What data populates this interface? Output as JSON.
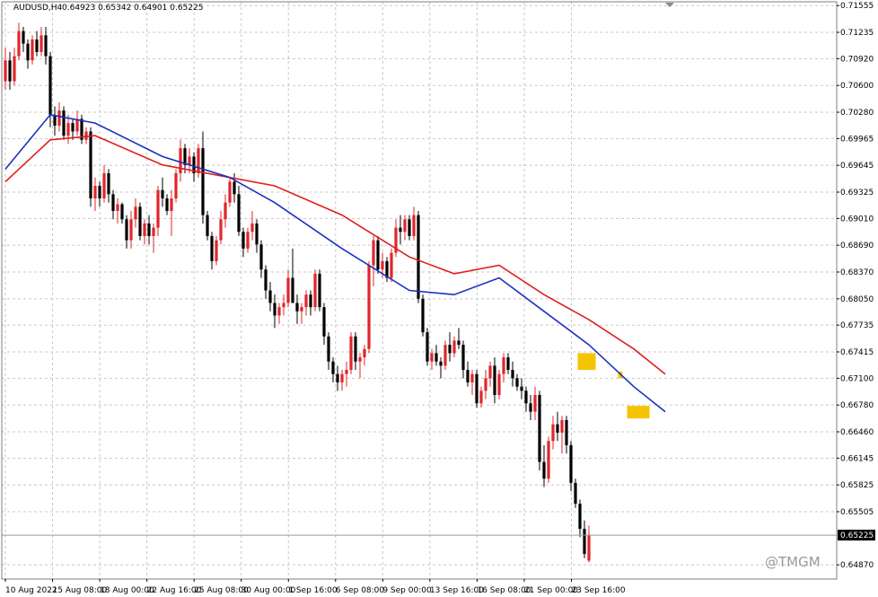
{
  "header": {
    "symbol": "AUDUSD,H4",
    "ohlc": "0.64923 0.65342 0.64901 0.65225"
  },
  "watermark": "@TMGM",
  "current_price_label": "0.65225",
  "colors": {
    "grid": "#c8c8c8",
    "bull": "#e0262b",
    "bear": "#000000",
    "ma_fast": "#1a2fc0",
    "ma_slow": "#e01e1e",
    "highlight": "#f5c400",
    "current_price_box": "#000000"
  },
  "chart_data": {
    "type": "candlestick",
    "title": "",
    "y_ticks": [
      "0.71555",
      "0.71235",
      "0.70920",
      "0.70600",
      "0.70280",
      "0.69965",
      "0.69645",
      "0.69325",
      "0.69010",
      "0.68690",
      "0.68370",
      "0.68050",
      "0.67735",
      "0.67415",
      "0.67100",
      "0.66780",
      "0.66460",
      "0.66145",
      "0.65825",
      "0.65505",
      "0.64870"
    ],
    "x_ticks": [
      "10 Aug 2022",
      "15 Aug 08:00",
      "18 Aug 00:00",
      "22 Aug 16:00",
      "25 Aug 08:00",
      "30 Aug 00:00",
      "1 Sep 16:00",
      "6 Sep 08:00",
      "9 Sep 00:00",
      "13 Sep 16:00",
      "16 Sep 08:00",
      "21 Sep 00:00",
      "23 Sep 16:00"
    ],
    "ylim": [
      0.647,
      0.716
    ],
    "candles": [
      [
        0.7065,
        0.7105,
        0.7055,
        0.709
      ],
      [
        0.709,
        0.71,
        0.7055,
        0.7065
      ],
      [
        0.7065,
        0.7105,
        0.706,
        0.7095
      ],
      [
        0.7095,
        0.7135,
        0.709,
        0.7125
      ],
      [
        0.7125,
        0.713,
        0.71,
        0.711
      ],
      [
        0.711,
        0.7115,
        0.708,
        0.709
      ],
      [
        0.709,
        0.712,
        0.7085,
        0.7115
      ],
      [
        0.7115,
        0.7125,
        0.7095,
        0.71
      ],
      [
        0.71,
        0.713,
        0.7095,
        0.712
      ],
      [
        0.712,
        0.713,
        0.7085,
        0.7095
      ],
      [
        0.7095,
        0.71,
        0.701,
        0.7025
      ],
      [
        0.7025,
        0.7035,
        0.7,
        0.7012
      ],
      [
        0.7012,
        0.704,
        0.7005,
        0.703
      ],
      [
        0.703,
        0.7035,
        0.6995,
        0.7
      ],
      [
        0.7,
        0.7025,
        0.699,
        0.7015
      ],
      [
        0.7015,
        0.702,
        0.6995,
        0.7005
      ],
      [
        0.7005,
        0.703,
        0.7,
        0.702
      ],
      [
        0.702,
        0.7025,
        0.699,
        0.6995
      ],
      [
        0.6995,
        0.701,
        0.699,
        0.7005
      ],
      [
        0.7005,
        0.701,
        0.6915,
        0.6925
      ],
      [
        0.6925,
        0.695,
        0.691,
        0.694
      ],
      [
        0.694,
        0.6945,
        0.6915,
        0.6925
      ],
      [
        0.6925,
        0.6965,
        0.692,
        0.6955
      ],
      [
        0.6955,
        0.696,
        0.692,
        0.693
      ],
      [
        0.693,
        0.6935,
        0.69,
        0.691
      ],
      [
        0.691,
        0.6925,
        0.6895,
        0.6918
      ],
      [
        0.6918,
        0.692,
        0.6895,
        0.69
      ],
      [
        0.69,
        0.6905,
        0.6865,
        0.6875
      ],
      [
        0.6875,
        0.691,
        0.6865,
        0.69
      ],
      [
        0.69,
        0.6925,
        0.689,
        0.6915
      ],
      [
        0.6915,
        0.692,
        0.6875,
        0.688
      ],
      [
        0.688,
        0.69,
        0.687,
        0.6895
      ],
      [
        0.6895,
        0.6905,
        0.687,
        0.688
      ],
      [
        0.688,
        0.6895,
        0.686,
        0.689
      ],
      [
        0.689,
        0.694,
        0.688,
        0.6935
      ],
      [
        0.6935,
        0.695,
        0.6915,
        0.6925
      ],
      [
        0.6925,
        0.693,
        0.6905,
        0.691
      ],
      [
        0.691,
        0.6935,
        0.688,
        0.6925
      ],
      [
        0.6925,
        0.696,
        0.692,
        0.6955
      ],
      [
        0.6955,
        0.6995,
        0.6945,
        0.6985
      ],
      [
        0.6985,
        0.699,
        0.6955,
        0.6965
      ],
      [
        0.6965,
        0.6985,
        0.6955,
        0.6975
      ],
      [
        0.6975,
        0.698,
        0.6945,
        0.6955
      ],
      [
        0.6955,
        0.699,
        0.695,
        0.6985
      ],
      [
        0.6985,
        0.7005,
        0.6895,
        0.6905
      ],
      [
        0.6905,
        0.691,
        0.6875,
        0.688
      ],
      [
        0.688,
        0.6885,
        0.684,
        0.685
      ],
      [
        0.685,
        0.688,
        0.6845,
        0.6875
      ],
      [
        0.6875,
        0.691,
        0.687,
        0.69
      ],
      [
        0.69,
        0.693,
        0.689,
        0.692
      ],
      [
        0.692,
        0.695,
        0.6915,
        0.6945
      ],
      [
        0.6945,
        0.6955,
        0.692,
        0.693
      ],
      [
        0.693,
        0.694,
        0.688,
        0.6885
      ],
      [
        0.6885,
        0.689,
        0.6855,
        0.6865
      ],
      [
        0.6865,
        0.689,
        0.686,
        0.6885
      ],
      [
        0.6885,
        0.691,
        0.6875,
        0.6895
      ],
      [
        0.6895,
        0.69,
        0.686,
        0.687
      ],
      [
        0.687,
        0.6875,
        0.683,
        0.684
      ],
      [
        0.684,
        0.6845,
        0.6805,
        0.6815
      ],
      [
        0.6815,
        0.6825,
        0.679,
        0.68
      ],
      [
        0.68,
        0.681,
        0.677,
        0.6785
      ],
      [
        0.6785,
        0.68,
        0.6775,
        0.6795
      ],
      [
        0.6795,
        0.681,
        0.6785,
        0.68
      ],
      [
        0.68,
        0.684,
        0.6795,
        0.683
      ],
      [
        0.683,
        0.6865,
        0.6825,
        0.68
      ],
      [
        0.68,
        0.681,
        0.6775,
        0.679
      ],
      [
        0.679,
        0.68,
        0.6775,
        0.6795
      ],
      [
        0.6795,
        0.6815,
        0.6785,
        0.681
      ],
      [
        0.681,
        0.6815,
        0.6785,
        0.6795
      ],
      [
        0.6795,
        0.684,
        0.679,
        0.6835
      ],
      [
        0.6835,
        0.684,
        0.679,
        0.6795
      ],
      [
        0.6795,
        0.68,
        0.675,
        0.676
      ],
      [
        0.676,
        0.6765,
        0.672,
        0.673
      ],
      [
        0.673,
        0.6735,
        0.6705,
        0.6715
      ],
      [
        0.6715,
        0.6725,
        0.6695,
        0.6705
      ],
      [
        0.6705,
        0.672,
        0.6695,
        0.6715
      ],
      [
        0.6715,
        0.673,
        0.67,
        0.672
      ],
      [
        0.672,
        0.6765,
        0.6715,
        0.676
      ],
      [
        0.676,
        0.6765,
        0.672,
        0.673
      ],
      [
        0.673,
        0.674,
        0.671,
        0.6735
      ],
      [
        0.6735,
        0.675,
        0.6725,
        0.6745
      ],
      [
        0.6745,
        0.685,
        0.674,
        0.6845
      ],
      [
        0.6845,
        0.688,
        0.682,
        0.6875
      ],
      [
        0.6875,
        0.688,
        0.6835,
        0.684
      ],
      [
        0.684,
        0.686,
        0.683,
        0.685
      ],
      [
        0.685,
        0.6855,
        0.6825,
        0.683
      ],
      [
        0.683,
        0.6865,
        0.6825,
        0.686
      ],
      [
        0.686,
        0.69,
        0.6855,
        0.689
      ],
      [
        0.689,
        0.6905,
        0.687,
        0.6885
      ],
      [
        0.6885,
        0.6905,
        0.6875,
        0.69
      ],
      [
        0.69,
        0.6905,
        0.6875,
        0.688
      ],
      [
        0.688,
        0.6915,
        0.6875,
        0.6905
      ],
      [
        0.6905,
        0.691,
        0.68,
        0.6805
      ],
      [
        0.6805,
        0.681,
        0.676,
        0.6765
      ],
      [
        0.6765,
        0.677,
        0.6725,
        0.673
      ],
      [
        0.673,
        0.6745,
        0.672,
        0.674
      ],
      [
        0.674,
        0.675,
        0.6725,
        0.673
      ],
      [
        0.673,
        0.6735,
        0.671,
        0.6725
      ],
      [
        0.6725,
        0.6755,
        0.672,
        0.675
      ],
      [
        0.675,
        0.6765,
        0.673,
        0.674
      ],
      [
        0.674,
        0.676,
        0.6735,
        0.6755
      ],
      [
        0.6755,
        0.677,
        0.6745,
        0.675
      ],
      [
        0.675,
        0.6755,
        0.671,
        0.672
      ],
      [
        0.672,
        0.673,
        0.67,
        0.6705
      ],
      [
        0.6705,
        0.672,
        0.669,
        0.6715
      ],
      [
        0.6715,
        0.672,
        0.6675,
        0.668
      ],
      [
        0.668,
        0.67,
        0.6675,
        0.6695
      ],
      [
        0.6695,
        0.672,
        0.6685,
        0.671
      ],
      [
        0.671,
        0.673,
        0.67,
        0.6725
      ],
      [
        0.6725,
        0.6735,
        0.668,
        0.669
      ],
      [
        0.669,
        0.672,
        0.6685,
        0.6715
      ],
      [
        0.6715,
        0.674,
        0.6705,
        0.6735
      ],
      [
        0.6735,
        0.674,
        0.6715,
        0.672
      ],
      [
        0.672,
        0.673,
        0.67,
        0.671
      ],
      [
        0.671,
        0.6715,
        0.6695,
        0.67
      ],
      [
        0.67,
        0.671,
        0.6685,
        0.6695
      ],
      [
        0.6695,
        0.67,
        0.667,
        0.668
      ],
      [
        0.668,
        0.669,
        0.666,
        0.667
      ],
      [
        0.667,
        0.67,
        0.666,
        0.669
      ],
      [
        0.669,
        0.6695,
        0.66,
        0.661
      ],
      [
        0.661,
        0.663,
        0.658,
        0.659
      ],
      [
        0.659,
        0.664,
        0.6585,
        0.6635
      ],
      [
        0.6635,
        0.6665,
        0.6625,
        0.6655
      ],
      [
        0.6655,
        0.667,
        0.6635,
        0.6645
      ],
      [
        0.6645,
        0.6665,
        0.662,
        0.666
      ],
      [
        0.666,
        0.6665,
        0.662,
        0.663
      ],
      [
        0.663,
        0.6635,
        0.6575,
        0.6585
      ],
      [
        0.6585,
        0.659,
        0.6555,
        0.656
      ],
      [
        0.656,
        0.6565,
        0.652,
        0.653
      ],
      [
        0.653,
        0.654,
        0.6495,
        0.65
      ],
      [
        0.6492,
        0.6534,
        0.649,
        0.6523
      ]
    ],
    "ma_fast": [
      [
        0,
        0.696
      ],
      [
        10,
        0.7025
      ],
      [
        20,
        0.7015
      ],
      [
        35,
        0.6975
      ],
      [
        50,
        0.695
      ],
      [
        60,
        0.692
      ],
      [
        75,
        0.6865
      ],
      [
        90,
        0.6815
      ],
      [
        100,
        0.681
      ],
      [
        110,
        0.683
      ],
      [
        120,
        0.679
      ],
      [
        130,
        0.675
      ],
      [
        140,
        0.67
      ],
      [
        147,
        0.667
      ]
    ],
    "ma_slow": [
      [
        0,
        0.6945
      ],
      [
        10,
        0.6995
      ],
      [
        20,
        0.7
      ],
      [
        35,
        0.6965
      ],
      [
        50,
        0.695
      ],
      [
        60,
        0.694
      ],
      [
        75,
        0.6905
      ],
      [
        90,
        0.6855
      ],
      [
        100,
        0.6835
      ],
      [
        110,
        0.6845
      ],
      [
        120,
        0.681
      ],
      [
        130,
        0.678
      ],
      [
        140,
        0.6745
      ],
      [
        147,
        0.6715
      ]
    ],
    "highlights": [
      {
        "from_index": 128,
        "to_index": 131,
        "low": 0.672,
        "high": 0.674
      },
      {
        "from_index": 137,
        "to_index": 137,
        "low": 0.671,
        "high": 0.6718
      },
      {
        "from_index": 139,
        "to_index": 143,
        "low": 0.6662,
        "high": 0.6677
      }
    ],
    "current_price": 0.65225
  }
}
